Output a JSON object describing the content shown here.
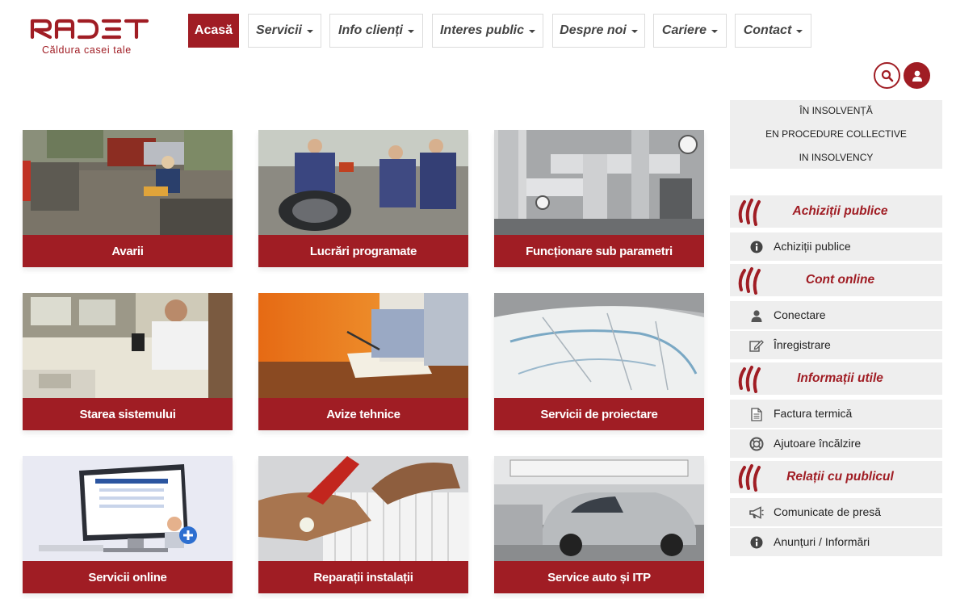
{
  "brand": {
    "name": "RADET",
    "tagline": "Căldura casei tale",
    "color": "#a01d24"
  },
  "nav": [
    {
      "label": "Acasă",
      "active": true
    },
    {
      "label": "Servicii"
    },
    {
      "label": "Info clienți"
    },
    {
      "label": "Interes public"
    },
    {
      "label": "Despre noi"
    },
    {
      "label": "Cariere"
    },
    {
      "label": "Contact"
    }
  ],
  "header_icons": [
    "search-icon",
    "user-icon"
  ],
  "tiles": [
    {
      "label": "Avarii"
    },
    {
      "label": "Lucrări programate"
    },
    {
      "label": "Funcționare sub parametri"
    },
    {
      "label": "Starea sistemului"
    },
    {
      "label": "Avize tehnice"
    },
    {
      "label": "Servicii de proiectare"
    },
    {
      "label": "Servicii online"
    },
    {
      "label": "Reparații instalații"
    },
    {
      "label": "Service auto și ITP"
    }
  ],
  "insolvency": {
    "line1": "ÎN INSOLVENȚĂ",
    "line2": "EN PROCEDURE COLLECTIVE",
    "line3": "IN INSOLVENCY"
  },
  "sidebar": {
    "sections": [
      {
        "title": "Achiziții publice",
        "items": [
          {
            "label": "Achiziții publice",
            "icon": "info-icon"
          }
        ]
      },
      {
        "title": "Cont online",
        "items": [
          {
            "label": "Conectare",
            "icon": "user-icon"
          },
          {
            "label": "Înregistrare",
            "icon": "edit-icon"
          }
        ]
      },
      {
        "title": "Informații utile",
        "items": [
          {
            "label": "Factura termică",
            "icon": "document-icon"
          },
          {
            "label": "Ajutoare încălzire",
            "icon": "lifebuoy-icon"
          }
        ]
      },
      {
        "title": "Relații cu publicul",
        "items": [
          {
            "label": "Comunicate de presă",
            "icon": "megaphone-icon"
          },
          {
            "label": "Anunțuri / Informări",
            "icon": "info-icon"
          }
        ]
      }
    ]
  }
}
